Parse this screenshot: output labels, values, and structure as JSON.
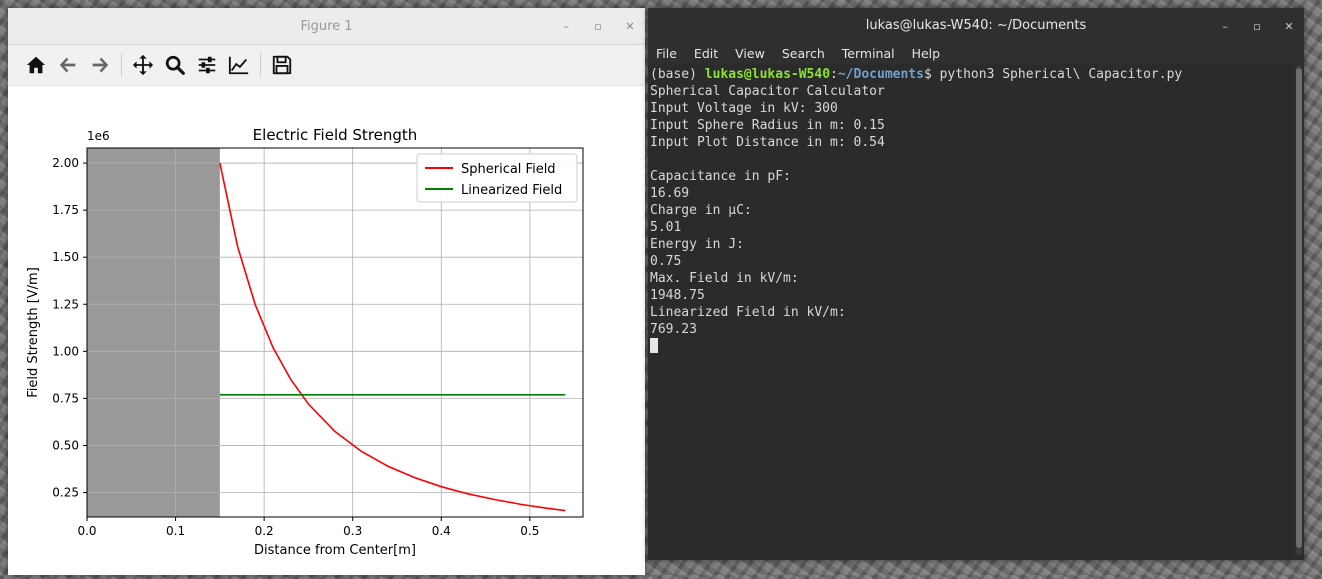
{
  "figure_window": {
    "title": "Figure 1",
    "controls": [
      "–",
      "▫",
      "✕"
    ],
    "toolbar": [
      "home-icon",
      "back-icon",
      "forward-icon",
      "pan-icon",
      "zoom-icon",
      "configure-icon",
      "edit-axis-icon",
      "save-icon"
    ]
  },
  "chart_data": {
    "type": "line",
    "title": "Electric Field Strength",
    "xlabel": "Distance from Center[m]",
    "ylabel": "Field Strength [V/m]",
    "y_offset_label": "1e6",
    "xlim": [
      0.0,
      0.56
    ],
    "ylim": [
      0.12,
      2.08
    ],
    "xticks": [
      0.0,
      0.1,
      0.2,
      0.3,
      0.4,
      0.5
    ],
    "xtick_labels": [
      "0.0",
      "0.1",
      "0.2",
      "0.3",
      "0.4",
      "0.5"
    ],
    "yticks": [
      0.25,
      0.5,
      0.75,
      1.0,
      1.25,
      1.5,
      1.75,
      2.0
    ],
    "ytick_labels": [
      "0.25",
      "0.50",
      "0.75",
      "1.00",
      "1.25",
      "1.50",
      "1.75",
      "2.00"
    ],
    "grid": true,
    "legend_position": "top-right",
    "sphere_region": {
      "x_from": 0.0,
      "x_to": 0.15,
      "color": "#999999"
    },
    "series": [
      {
        "name": "Spherical Field",
        "color": "#ff0000",
        "x": [
          0.15,
          0.17,
          0.19,
          0.21,
          0.23,
          0.25,
          0.28,
          0.31,
          0.34,
          0.37,
          0.4,
          0.43,
          0.46,
          0.49,
          0.52,
          0.54
        ],
        "values": [
          2.0,
          1.557,
          1.247,
          1.02,
          0.851,
          0.72,
          0.574,
          0.468,
          0.389,
          0.329,
          0.281,
          0.243,
          0.213,
          0.187,
          0.166,
          0.154
        ]
      },
      {
        "name": "Linearized Field",
        "color": "#008000",
        "x": [
          0.15,
          0.54
        ],
        "values": [
          0.769,
          0.769
        ]
      }
    ]
  },
  "terminal": {
    "title": "lukas@lukas-W540: ~/Documents",
    "controls": [
      "–",
      "▫",
      "✕"
    ],
    "menu": [
      "File",
      "Edit",
      "View",
      "Search",
      "Terminal",
      "Help"
    ],
    "prompt_prefix": "(base) ",
    "prompt_user": "lukas@lukas-W540",
    "prompt_sep": ":",
    "prompt_path": "~/Documents",
    "prompt_symbol": "$ ",
    "command": "python3 Spherical\\ Capacitor.py",
    "output_lines": [
      "Spherical Capacitor Calculator",
      "Input Voltage in kV: 300",
      "Input Sphere Radius in m: 0.15",
      "Input Plot Distance in m: 0.54",
      "",
      "Capacitance in pF:",
      "16.69",
      "Charge in µC:",
      "5.01",
      "Energy in J:",
      "0.75",
      "Max. Field in kV/m:",
      "1948.75",
      "Linearized Field in kV/m:",
      "769.23"
    ]
  }
}
